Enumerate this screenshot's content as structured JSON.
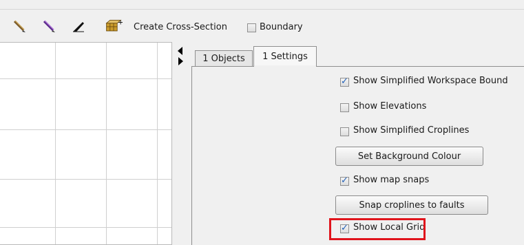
{
  "toolbar": {
    "tools": [
      {
        "icon": "pencil-brown-icon"
      },
      {
        "icon": "pencil-purple-icon"
      },
      {
        "icon": "knife-icon"
      },
      {
        "icon": "create-cross-section-icon"
      }
    ],
    "create_cross_section_label": "Create Cross-Section",
    "boundary_label": "Boundary",
    "boundary_checked": false
  },
  "tabs": [
    {
      "label": "1 Objects",
      "active": false
    },
    {
      "label": "1 Settings",
      "active": true
    }
  ],
  "settings": {
    "show_simplified_workspace_boundary": {
      "label": "Show Simplified Workspace Bound",
      "checked": true
    },
    "show_elevations": {
      "label": "Show Elevations",
      "checked": false
    },
    "show_simplified_croplines": {
      "label": "Show Simplified Croplines",
      "checked": false
    },
    "set_background_colour_button": "Set Background Colour",
    "show_map_snaps": {
      "label": "Show map snaps",
      "checked": true
    },
    "snap_croplines_button": "Snap croplines to faults",
    "show_local_grid": {
      "label": "Show Local Grid",
      "checked": true
    }
  },
  "colors": {
    "highlight": "#e0141c",
    "check": "#1f5fb8"
  }
}
